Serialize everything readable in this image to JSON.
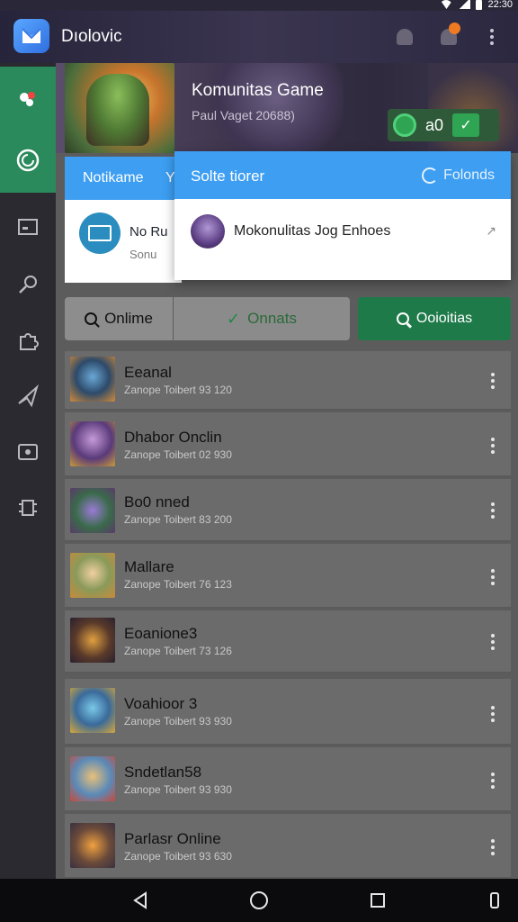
{
  "app": {
    "title": "Dıolovic"
  },
  "hero": {
    "title": "Komunitas Game",
    "subtitle": "Paul Vaget 20688)",
    "pill_count": "a0"
  },
  "notif_card": {
    "header": "Notikame",
    "header_suffix": "Y",
    "line1": "No Ru",
    "line2": "Sonu"
  },
  "popup": {
    "title": "Solte tiorer",
    "action": "Folonds",
    "item_text": "Mokonulitas Jog Enhoes",
    "item_arrow": "↗"
  },
  "filters": {
    "tab1": "Onlime",
    "tab2": "Onnats",
    "search_button": "Ooioitias"
  },
  "list": {
    "items": [
      {
        "title": "Eeanal",
        "subtitle": "Zanope Toibert 93 120"
      },
      {
        "title": "Dhabor Onclin",
        "subtitle": "Zanope Toibert 02 930"
      },
      {
        "title": "Bo0 nned",
        "subtitle": "Zanope Toibert 83 200"
      },
      {
        "title": "Mallare",
        "subtitle": "Zanope Toibert 76 123"
      },
      {
        "title": "Eoanione3",
        "subtitle": "Zanope Toibert 73 126"
      },
      {
        "title": "Voahioor 3",
        "subtitle": "Zanope Toibert 93 930"
      },
      {
        "title": "Sndetlan58",
        "subtitle": "Zanope Toibert 93 930"
      },
      {
        "title": "Parlasr Online",
        "subtitle": "Zanope Toibert 93 630"
      }
    ]
  },
  "status_bar": {
    "time": "22:30"
  },
  "colors": {
    "accent_blue": "#3d9ef2",
    "accent_green": "#1f7a4a",
    "sidebar_active": "#2a8a5b"
  }
}
